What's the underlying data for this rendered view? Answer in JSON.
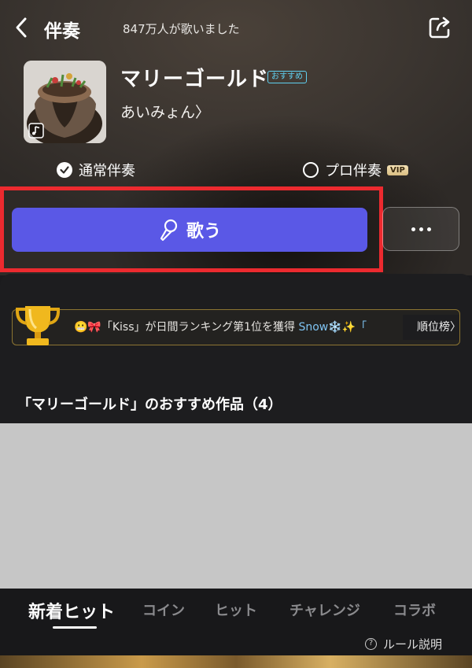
{
  "header": {
    "title": "伴奏",
    "singer_count": "847万人が歌いました"
  },
  "song": {
    "title": "マリーゴールド",
    "badge": "おすすめ",
    "artist": "あいみょん〉"
  },
  "modes": {
    "normal_label": "通常伴奏",
    "pro_label": "プロ伴奏",
    "vip_badge": "VIP"
  },
  "actions": {
    "sing_label": "歌う"
  },
  "ticker": {
    "prefix": "😬🎀「Kiss」が日間ランキング第1位を獲得 ",
    "name": "Snow❄️✨「",
    "ranking_label": "順位榜〉"
  },
  "section": {
    "title": "「マリーゴールド」のおすすめ作品（4）"
  },
  "tabs": [
    {
      "label": "新着ヒット",
      "active": true
    },
    {
      "label": "コイン"
    },
    {
      "label": "ヒット"
    },
    {
      "label": "チャレンジ"
    },
    {
      "label": "コラボ"
    }
  ],
  "footer": {
    "rules_label": "ルール説明"
  },
  "colors": {
    "accent": "#5a58e6",
    "highlight": "#ec2a2f",
    "badge": "#5fd0f0",
    "gold": "#8d7532"
  }
}
